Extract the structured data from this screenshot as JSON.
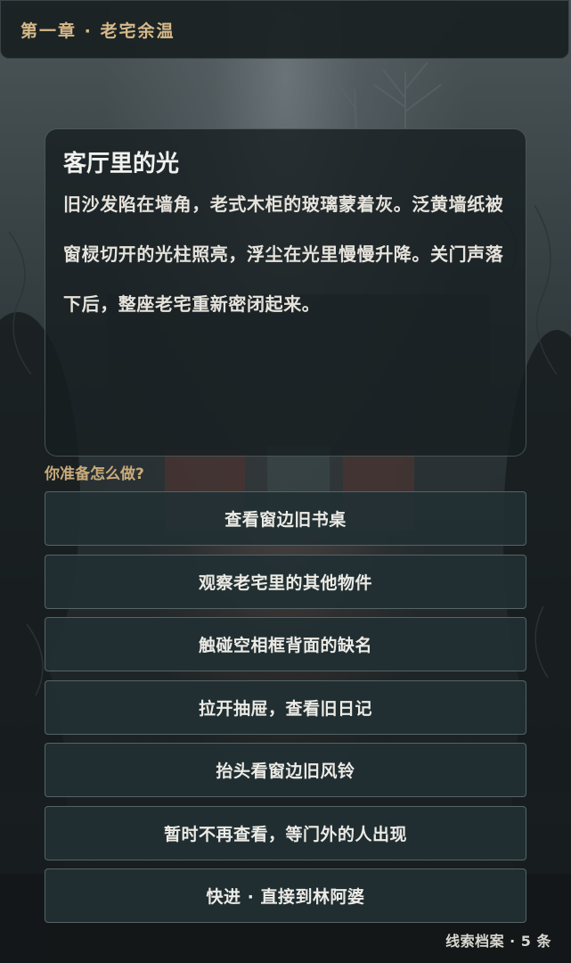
{
  "header": {
    "chapter_title": "第一章 · 老宅余温"
  },
  "story": {
    "heading": "客厅里的光",
    "text": "旧沙发陷在墙角，老式木柜的玻璃蒙着灰。泛黄墙纸被窗棂切开的光柱照亮，浮尘在光里慢慢升降。关门声落下后，整座老宅重新密闭起来。"
  },
  "prompt": "你准备怎么做?",
  "choices": [
    {
      "label": "查看窗边旧书桌"
    },
    {
      "label": "观察老宅里的其他物件"
    },
    {
      "label": "触碰空相框背面的缺名"
    },
    {
      "label": "拉开抽屉，查看旧日记"
    },
    {
      "label": "抬头看窗边旧风铃"
    },
    {
      "label": "暂时不再查看，等门外的人出现"
    },
    {
      "label": "快进 · 直接到林阿婆"
    }
  ],
  "footer": {
    "archive_label": "线索档案 · 5 条"
  },
  "colors": {
    "accent": "#d7b98a",
    "card_bg": "#161e20",
    "button_bg": "#223033"
  }
}
